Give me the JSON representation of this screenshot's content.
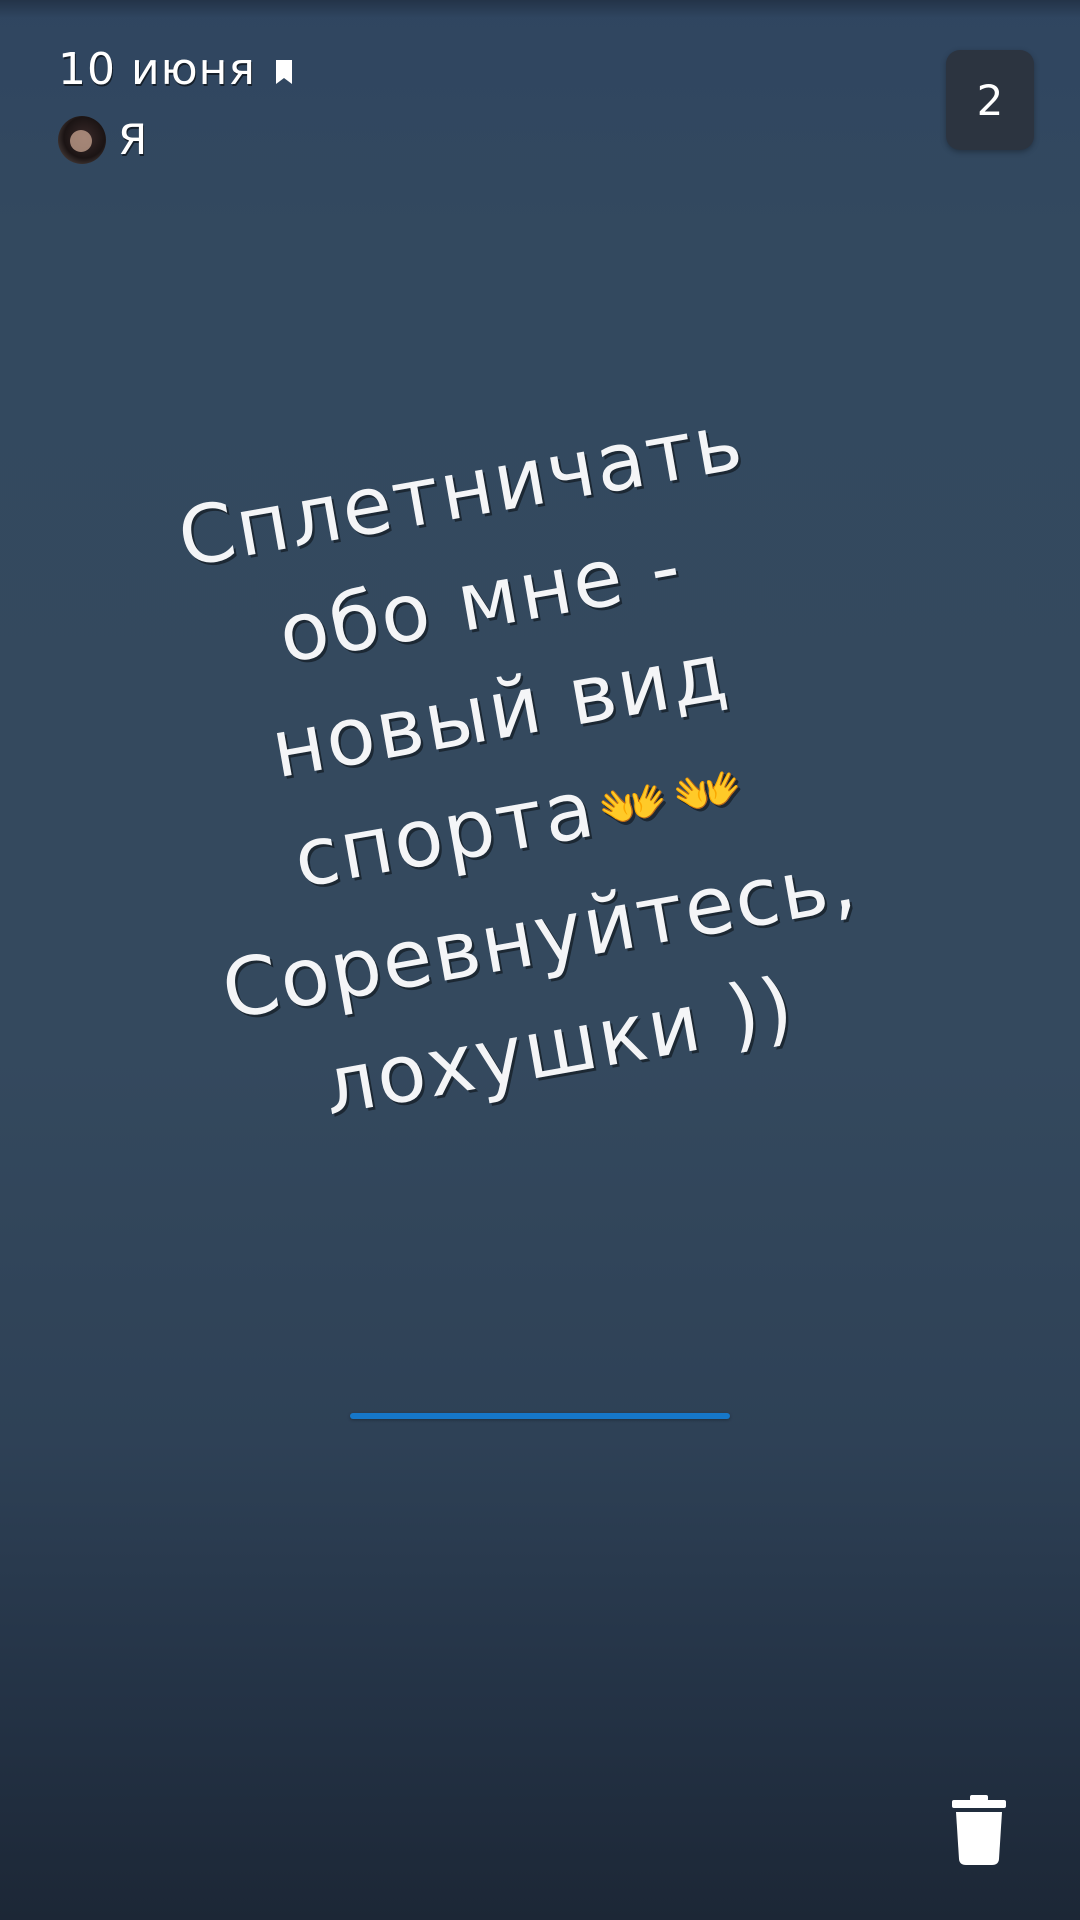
{
  "header": {
    "date": "10 июня",
    "author": "Я",
    "bookmark_icon": "bookmark-icon",
    "avatar_icon": "avatar"
  },
  "counter": {
    "value": "2"
  },
  "story": {
    "lines": [
      "Сплетничать",
      "обо мне -",
      "новый вид",
      "спорта",
      "Соревнуйтесь,",
      "лохушки ))"
    ],
    "emoji": "👐"
  },
  "footer": {
    "delete_icon": "trash-icon"
  },
  "colors": {
    "background": "#34495e",
    "text": "#f4f5f7",
    "accent": "#1677c9",
    "badge": "#2c3440"
  }
}
